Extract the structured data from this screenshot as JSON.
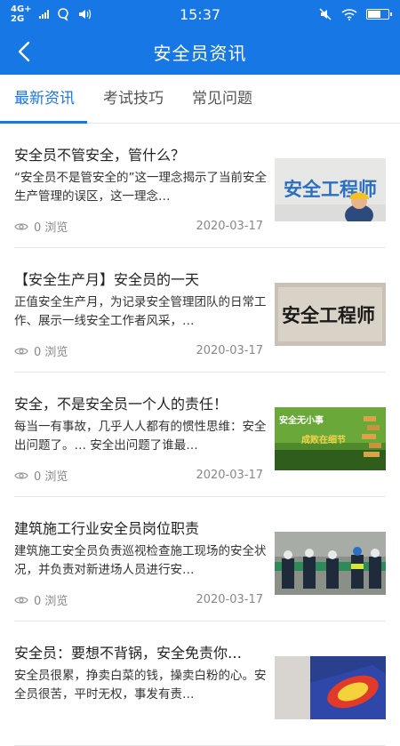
{
  "status": {
    "network_top": "4G+",
    "network_bottom": "2G",
    "time": "15:37"
  },
  "header": {
    "title": "安全员资讯"
  },
  "tabs": [
    {
      "label": "最新资讯",
      "active": true
    },
    {
      "label": "考试技巧",
      "active": false
    },
    {
      "label": "常见问题",
      "active": false
    }
  ],
  "articles": [
    {
      "title": "安全员不管安全，管什么？",
      "summary": "“安全员不是管安全的”这一理念揭示了当前安全生产管理的误区，这一理念…",
      "views": "0 浏览",
      "date": "2020-03-17",
      "thumb_text": "安全工程师"
    },
    {
      "title": "【安全生产月】安全员的一天",
      "summary": "正值安全生产月，为记录安全管理团队的日常工作、展示一线安全工作者风采，…",
      "views": "0 浏览",
      "date": "2020-03-17",
      "thumb_text": "安全工程师"
    },
    {
      "title": "安全，不是安全员一个人的责任！",
      "summary": "每当一有事故，几乎人人都有的惯性思维：安全出问题了。… 安全出问题了谁最…",
      "views": "0 浏览",
      "date": "2020-03-17",
      "thumb_text_1": "安全无小事",
      "thumb_text_2": "成败在细节"
    },
    {
      "title": "建筑施工行业安全员岗位职责",
      "summary": "建筑施工安全员负责巡视检查施工现场的安全状况，并负责对新进场人员进行安…",
      "views": "0 浏览",
      "date": "2020-03-17"
    },
    {
      "title": "安全员：要想不背锅，安全免责你…",
      "summary": "安全员很累，挣卖白菜的钱，操卖白粉的心。安全员很苦，平时无权，事发有责…",
      "views": "",
      "date": ""
    }
  ]
}
